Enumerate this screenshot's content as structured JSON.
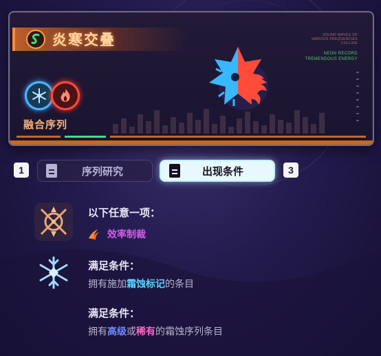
{
  "card": {
    "title": "炎寒交叠",
    "fusion_label": "融合序列",
    "side_text_lines": [
      "SOUND WAVES OF",
      "VARIOUS FREQUENCIES",
      "COLLIDE"
    ],
    "side_text_green": [
      "NEON RECORD",
      "TREMENDOUS ENERGY"
    ]
  },
  "tabs": {
    "num_left": "1",
    "num_right": "3",
    "items": [
      {
        "label": "序列研究",
        "active": false
      },
      {
        "label": "出现条件",
        "active": true
      }
    ]
  },
  "conditions": [
    {
      "heading": "以下任意一项：",
      "trait": "效率制裁"
    },
    {
      "heading": "满足条件：",
      "text_before": "拥有施加",
      "highlight": "霜蚀标记",
      "text_after": "的条目"
    },
    {
      "heading": "满足条件：",
      "text_before": "拥有",
      "highlight1": "高级",
      "middle": "或",
      "highlight2": "稀有",
      "text_after": "的霜蚀序列条目"
    }
  ],
  "colors": {
    "accent_orange": "#ff8a3a",
    "ice_blue": "#4cb8ff",
    "fire_red": "#ff4a3a",
    "highlight_cyan": "#55d6ff",
    "highlight_blue": "#6d8bff",
    "highlight_pink": "#ff66c8",
    "trait_purple": "#d45bea"
  },
  "icons": [
    "sequence-s-icon",
    "snowflake-icon",
    "flame-icon",
    "ice-fire-emblem-icon",
    "document-icon",
    "crossbow-icon",
    "claw-trait-icon",
    "frost-snowflake-icon"
  ]
}
